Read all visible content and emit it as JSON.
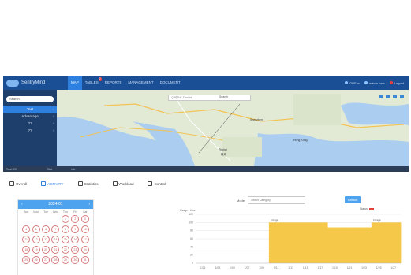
{
  "app": {
    "name": "SentryMind"
  },
  "nav": {
    "tabs": [
      {
        "label": "MAP",
        "active": true
      },
      {
        "label": "TABLES",
        "badge": "2"
      },
      {
        "label": "REPORTS"
      },
      {
        "label": "MANAGEMENT"
      },
      {
        "label": "DOCUMENT"
      }
    ],
    "right": {
      "account": "GPS rc",
      "user": "admin user",
      "logout": "Logout"
    }
  },
  "sidebar": {
    "search_placeholder": "Search",
    "items": [
      {
        "label": "Test",
        "active": true
      },
      {
        "label": "Advantage"
      },
      {
        "label": "??"
      },
      {
        "label": "??"
      }
    ]
  },
  "map": {
    "search_placeholder": "Q 可TH1 Trackid",
    "search_button": "Search",
    "labels": [
      "Zhuhai",
      "Shenzhen",
      "Hong Kong",
      "珠海"
    ]
  },
  "statusbar": {
    "left": "Total: 999 ·",
    "mid": "Stat: ·",
    "right": "Info ·"
  },
  "tabs": [
    {
      "label": "Overall",
      "icon": "overall-icon"
    },
    {
      "label": "ACTIVITY",
      "icon": "activity-icon",
      "active": true
    },
    {
      "label": "Statistics",
      "icon": "statistics-icon"
    },
    {
      "label": "Workload",
      "icon": "workload-icon"
    },
    {
      "label": "Control",
      "icon": "control-icon"
    }
  ],
  "calendar": {
    "month": "2024-01",
    "weekdays": [
      "Sun",
      "Mon",
      "Tue",
      "Wed",
      "Thu",
      "Fri",
      "Sat"
    ],
    "days": [
      "",
      "",
      "",
      "",
      "1",
      "2",
      "3",
      "4",
      "5",
      "6",
      "7",
      "8",
      "9",
      "10",
      "11",
      "12",
      "13",
      "14",
      "15",
      "16",
      "17",
      "18",
      "19",
      "20",
      "21",
      "22",
      "23",
      "24",
      "25",
      "26",
      "27",
      "28",
      "29",
      "30",
      "31"
    ]
  },
  "chart_controls": {
    "label": "Mode",
    "select_value": "Select Category",
    "search_button": "Search"
  },
  "chart_data": {
    "type": "bar",
    "title": "",
    "ylabel": "Usage / time",
    "categories": [
      "1/01",
      "1/03",
      "1/05",
      "1/07",
      "1/09",
      "1/11",
      "1/13",
      "1/15",
      "1/17",
      "1/19",
      "1/21",
      "1/23",
      "1/25",
      "1/27"
    ],
    "values": [
      0,
      0,
      0,
      0,
      0,
      100,
      100,
      100,
      100,
      88,
      88,
      88,
      100,
      100
    ],
    "ylim": [
      0,
      120
    ],
    "yticks": [
      0,
      20,
      40,
      60,
      80,
      100,
      120
    ],
    "legend": [
      {
        "name": "Status",
        "color": "#e34040"
      }
    ],
    "bar_color": "#f5c84a",
    "top_labels": [
      "Usage",
      "Usage"
    ]
  }
}
